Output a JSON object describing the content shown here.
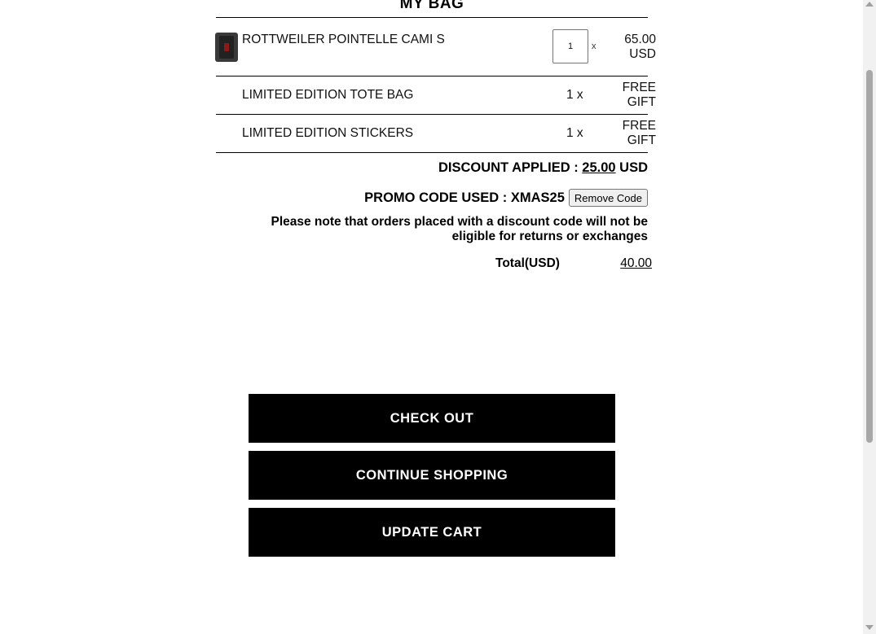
{
  "page": {
    "title": "MY BAG"
  },
  "items": [
    {
      "name": "ROTTWEILER POINTELLE CAMI S",
      "quantity": "1",
      "qty_suffix": "x",
      "price": "65.00",
      "currency": "USD",
      "thumbnail": "product-thumbnail"
    },
    {
      "name": "LIMITED EDITION TOTE BAG",
      "qty_label": "1 x",
      "price_line1": "FREE",
      "price_line2": "GIFT"
    },
    {
      "name": "LIMITED EDITION STICKERS",
      "qty_label": "1 x",
      "price_line1": "FREE",
      "price_line2": "GIFT"
    }
  ],
  "summary": {
    "discount_label": "DISCOUNT APPLIED : ",
    "discount_amount": "25.00",
    "discount_currency": " USD",
    "promo_label": "PROMO CODE USED : XMAS25",
    "remove_code_label": "Remove Code",
    "note": "Please note that orders placed with a discount code will not be eligible for returns or exchanges",
    "total_label": "Total(USD)",
    "total_value": "40.00"
  },
  "actions": {
    "checkout": "CHECK OUT",
    "continue_shopping": "CONTINUE SHOPPING",
    "update_cart": "UPDATE CART"
  }
}
